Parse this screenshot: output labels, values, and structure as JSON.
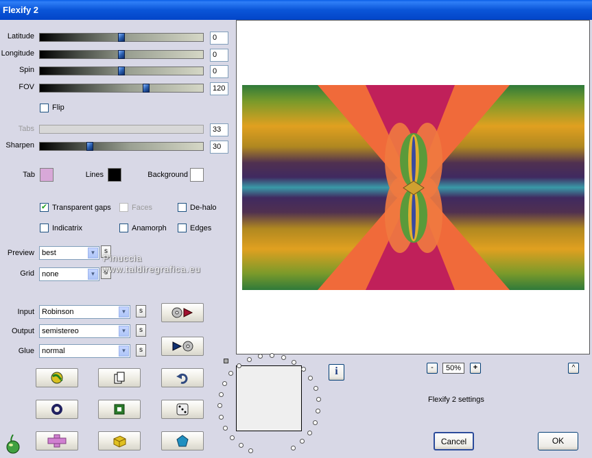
{
  "window": {
    "title": "Flexify 2"
  },
  "sliders": {
    "latitude": {
      "label": "Latitude",
      "value": "0",
      "level": 0.5
    },
    "longitude": {
      "label": "Longitude",
      "value": "0",
      "level": 0.5
    },
    "spin": {
      "label": "Spin",
      "value": "0",
      "level": 0.5
    },
    "fov": {
      "label": "FOV",
      "value": "120",
      "level": 0.66
    },
    "tabs": {
      "label": "Tabs",
      "value": "33"
    },
    "sharpen": {
      "label": "Sharpen",
      "value": "30",
      "level": 0.3
    }
  },
  "flip": {
    "label": "Flip",
    "checked": false
  },
  "colors": {
    "tab": {
      "label": "Tab",
      "color": "#d8a8d8"
    },
    "lines": {
      "label": "Lines",
      "color": "#000000"
    },
    "background": {
      "label": "Background",
      "color": "#ffffff"
    }
  },
  "options": {
    "transparent_gaps": {
      "label": "Transparent gaps",
      "checked": true
    },
    "faces": {
      "label": "Faces",
      "checked": false
    },
    "de_halo": {
      "label": "De-halo",
      "checked": false
    },
    "indicatrix": {
      "label": "Indicatrix",
      "checked": false
    },
    "anamorph": {
      "label": "Anamorph",
      "checked": false
    },
    "edges": {
      "label": "Edges",
      "checked": false
    }
  },
  "preview_select": {
    "label": "Preview",
    "value": "best",
    "s": "s"
  },
  "grid_select": {
    "label": "Grid",
    "value": "none",
    "s": "s"
  },
  "input_select": {
    "label": "Input",
    "value": "Robinson",
    "s": "s"
  },
  "output_select": {
    "label": "Output",
    "value": "semistereo",
    "s": "s"
  },
  "glue_select": {
    "label": "Glue",
    "value": "normal",
    "s": "s"
  },
  "watermark": {
    "line1": "Pinuccia",
    "line2": "www.taldiregrafica.eu"
  },
  "zoom": {
    "minus": "-",
    "value": "50%",
    "plus": "+"
  },
  "collapse_label": "^",
  "info_label": "i",
  "settings_label": "Flexify 2 settings",
  "buttons": {
    "cancel": "Cancel",
    "ok": "OK"
  },
  "icons": {
    "input_to_output": "cd-arrow-icon",
    "output_to_input": "arrow-cd-icon",
    "globe": "globe-icon",
    "copy": "copy-icon",
    "undo": "undo-icon",
    "ring": "ring-icon",
    "square": "square-icon",
    "dice": "dice-icon",
    "cross": "cross-icon",
    "cube": "cube-icon",
    "pentagon": "pentagon-icon",
    "logo": "flaming-pear-icon"
  }
}
